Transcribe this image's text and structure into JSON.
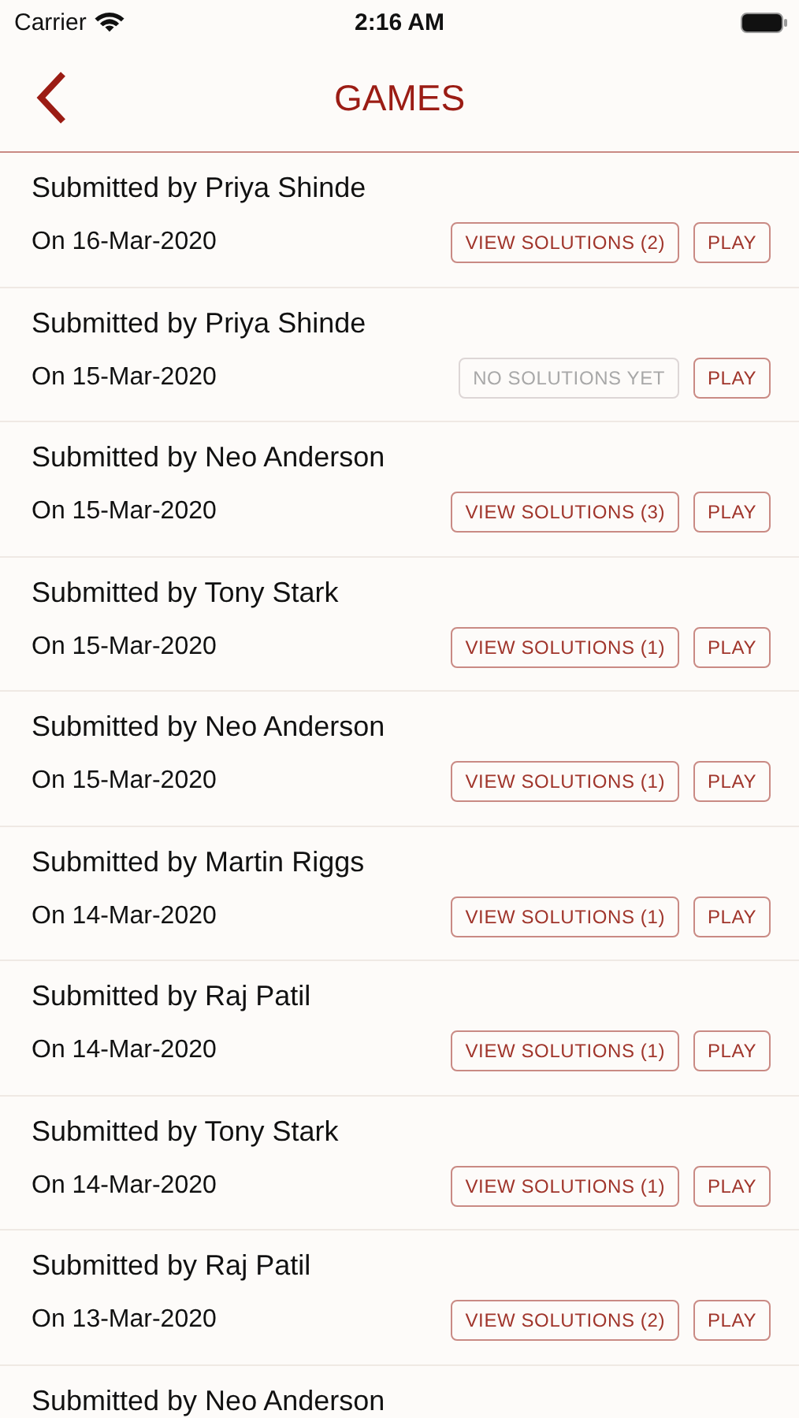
{
  "status_bar": {
    "carrier": "Carrier",
    "time": "2:16 AM"
  },
  "nav": {
    "title": "GAMES"
  },
  "rows": [
    {
      "title": "Submitted by Priya Shinde",
      "date": "On 16-Mar-2020",
      "solutions": {
        "label": "VIEW SOLUTIONS (2)",
        "disabled": false
      },
      "play": "PLAY"
    },
    {
      "title": "Submitted by Priya Shinde",
      "date": "On 15-Mar-2020",
      "solutions": {
        "label": "NO SOLUTIONS YET",
        "disabled": true
      },
      "play": "PLAY"
    },
    {
      "title": "Submitted by Neo Anderson",
      "date": "On 15-Mar-2020",
      "solutions": {
        "label": "VIEW SOLUTIONS (3)",
        "disabled": false
      },
      "play": "PLAY"
    },
    {
      "title": "Submitted by Tony Stark",
      "date": "On 15-Mar-2020",
      "solutions": {
        "label": "VIEW SOLUTIONS (1)",
        "disabled": false
      },
      "play": "PLAY"
    },
    {
      "title": "Submitted by Neo Anderson",
      "date": "On 15-Mar-2020",
      "solutions": {
        "label": "VIEW SOLUTIONS (1)",
        "disabled": false
      },
      "play": "PLAY"
    },
    {
      "title": "Submitted by Martin Riggs",
      "date": "On 14-Mar-2020",
      "solutions": {
        "label": "VIEW SOLUTIONS (1)",
        "disabled": false
      },
      "play": "PLAY"
    },
    {
      "title": "Submitted by Raj Patil",
      "date": "On 14-Mar-2020",
      "solutions": {
        "label": "VIEW SOLUTIONS (1)",
        "disabled": false
      },
      "play": "PLAY"
    },
    {
      "title": "Submitted by Tony Stark",
      "date": "On 14-Mar-2020",
      "solutions": {
        "label": "VIEW SOLUTIONS (1)",
        "disabled": false
      },
      "play": "PLAY"
    },
    {
      "title": "Submitted by Raj Patil",
      "date": "On 13-Mar-2020",
      "solutions": {
        "label": "VIEW SOLUTIONS (2)",
        "disabled": false
      },
      "play": "PLAY"
    },
    {
      "title": "Submitted by Neo Anderson"
    }
  ]
}
